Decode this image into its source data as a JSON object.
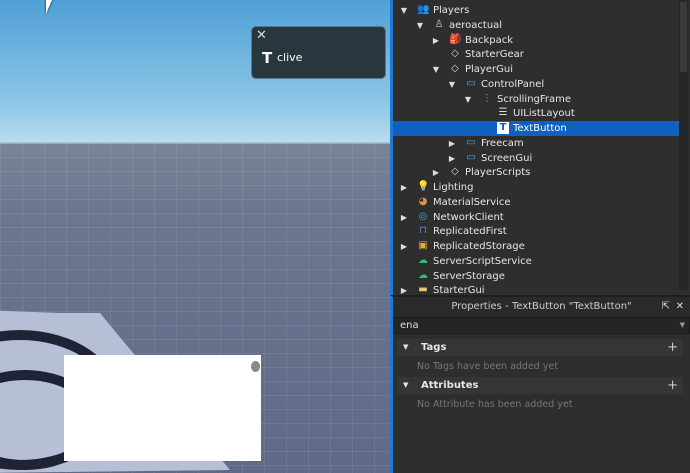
{
  "notification": {
    "close": "✕",
    "user": "clive"
  },
  "explorer": {
    "items": [
      {
        "label": "Players",
        "depth": 0,
        "arrow": "down",
        "icon": "players-icon",
        "glyph": "👥",
        "color": "#e0a030"
      },
      {
        "label": "aeroactual",
        "depth": 1,
        "arrow": "down",
        "icon": "player-icon",
        "glyph": "♙",
        "color": "#ccc"
      },
      {
        "label": "Backpack",
        "depth": 2,
        "arrow": "right",
        "icon": "backpack-icon",
        "glyph": "🎒",
        "color": "#ddd"
      },
      {
        "label": "StarterGear",
        "depth": 2,
        "arrow": "",
        "icon": "folder-diamond-icon",
        "glyph": "◇",
        "color": "#ddd"
      },
      {
        "label": "PlayerGui",
        "depth": 2,
        "arrow": "down",
        "icon": "diamond-icon",
        "glyph": "◇",
        "color": "#ddd"
      },
      {
        "label": "ControlPanel",
        "depth": 3,
        "arrow": "down",
        "icon": "screengui-icon",
        "glyph": "▭",
        "color": "#4ea3e0"
      },
      {
        "label": "ScrollingFrame",
        "depth": 4,
        "arrow": "down",
        "icon": "scrollingframe-icon",
        "glyph": "⋮",
        "color": "#4cc04c"
      },
      {
        "label": "UIListLayout",
        "depth": 5,
        "arrow": "",
        "icon": "list-layout-icon",
        "glyph": "☰",
        "color": "#ddd"
      },
      {
        "label": "TextButton",
        "depth": 5,
        "arrow": "",
        "icon": "textbutton-icon",
        "glyph": "T",
        "color": "#fff",
        "selected": true
      },
      {
        "label": "Freecam",
        "depth": 3,
        "arrow": "right",
        "icon": "screengui-icon",
        "glyph": "▭",
        "color": "#4ea3e0"
      },
      {
        "label": "ScreenGui",
        "depth": 3,
        "arrow": "right",
        "icon": "screengui-icon",
        "glyph": "▭",
        "color": "#4ea3e0"
      },
      {
        "label": "PlayerScripts",
        "depth": 2,
        "arrow": "right",
        "icon": "diamond-icon",
        "glyph": "◇",
        "color": "#ddd"
      },
      {
        "label": "Lighting",
        "depth": 0,
        "arrow": "right",
        "icon": "lightbulb-icon",
        "glyph": "💡",
        "color": "#f0d020"
      },
      {
        "label": "MaterialService",
        "depth": 0,
        "arrow": "",
        "icon": "material-service-icon",
        "glyph": "◕",
        "color": "#e09040"
      },
      {
        "label": "NetworkClient",
        "depth": 0,
        "arrow": "right",
        "icon": "network-client-icon",
        "glyph": "◎",
        "color": "#40b0e0"
      },
      {
        "label": "ReplicatedFirst",
        "depth": 0,
        "arrow": "",
        "icon": "replicated-first-icon",
        "glyph": "⊓",
        "color": "#5a8ae0"
      },
      {
        "label": "ReplicatedStorage",
        "depth": 0,
        "arrow": "right",
        "icon": "replicated-storage-icon",
        "glyph": "▣",
        "color": "#e0b030"
      },
      {
        "label": "ServerScriptService",
        "depth": 0,
        "arrow": "",
        "icon": "server-script-service-icon",
        "glyph": "☁",
        "color": "#30c070"
      },
      {
        "label": "ServerStorage",
        "depth": 0,
        "arrow": "",
        "icon": "server-storage-icon",
        "glyph": "☁",
        "color": "#30c070"
      },
      {
        "label": "StarterGui",
        "depth": 0,
        "arrow": "right",
        "icon": "folder-icon",
        "glyph": "▬",
        "color": "#e8c870"
      }
    ]
  },
  "properties": {
    "title": "Properties - TextButton \"TextButton\"",
    "filter_value": "ena",
    "tags_header": "Tags",
    "tags_empty": "No Tags have been added yet",
    "attributes_header": "Attributes",
    "attributes_empty": "No Attribute has been added yet",
    "plus": "+"
  }
}
